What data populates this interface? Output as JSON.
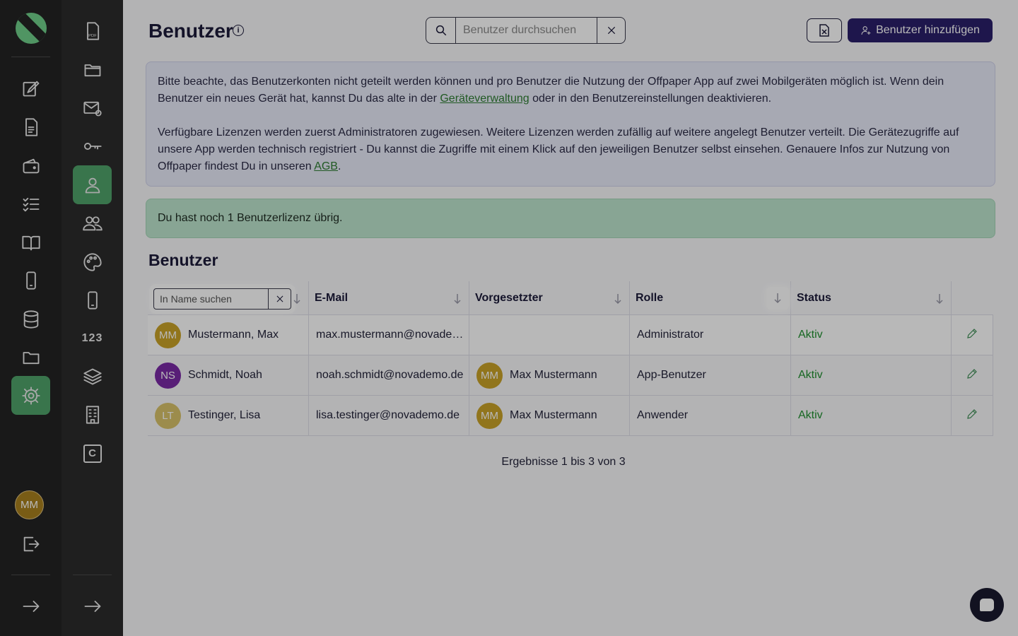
{
  "app": {
    "page_title": "Benutzer",
    "info_icon": "info-icon"
  },
  "search": {
    "placeholder": "Benutzer durchsuchen",
    "value": ""
  },
  "toolbar": {
    "export_icon": "excel-export-icon",
    "add_user_label": "Benutzer hinzufügen",
    "accent_color": "#2a1f6a"
  },
  "notice": {
    "p1_before_link": "Bitte beachte, das Benutzerkonten nicht geteilt werden können und pro Benutzer die Nutzung der Offpaper App auf zwei Mobilgeräten möglich ist. Wenn dein Benutzer ein neues Gerät hat, kannst Du das alte in der ",
    "p1_link": "Geräteverwaltung",
    "p1_after_link": " oder in den Benutzereinstellungen deaktivieren.",
    "p2_before_link": "Verfügbare Lizenzen werden zuerst Administratoren zugewiesen. Weitere Lizenzen werden zufällig auf weitere angelegt Benutzer verteilt. Die Gerätezugriffe auf unsere App werden technisch registriert - Du kannst die Zugriffe mit einem Klick auf den jeweiligen Benutzer selbst einsehen. Genauere Infos zur Nutzung von Offpaper findest Du in unseren ",
    "p2_link": "AGB",
    "p2_after_link": "."
  },
  "license_notice": "Du hast noch 1 Benutzerlizenz übrig.",
  "section_title": "Benutzer",
  "table": {
    "name_filter_placeholder": "In Name suchen",
    "columns": [
      "Name",
      "E-Mail",
      "Vorgesetzter",
      "Rolle",
      "Status"
    ],
    "rows": [
      {
        "initials": "MM",
        "avatar_color": "#c9a227",
        "name": "Mustermann, Max",
        "email": "max.mustermann@novade…",
        "boss_initials": "",
        "boss": "",
        "role": "Administrator",
        "status": "Aktiv"
      },
      {
        "initials": "NS",
        "avatar_color": "#7b2aa6",
        "name": "Schmidt, Noah",
        "email": "noah.schmidt@novademo.de",
        "boss_initials": "MM",
        "boss": "Max Mustermann",
        "role": "App-Benutzer",
        "status": "Aktiv"
      },
      {
        "initials": "LT",
        "avatar_color": "#d8c26a",
        "name": "Testinger, Lisa",
        "email": "lisa.testinger@novademo.de",
        "boss_initials": "MM",
        "boss": "Max Mustermann",
        "role": "Anwender",
        "status": "Aktiv"
      }
    ],
    "boss_avatar_color": "#c9a227",
    "status_color": "#1f8f2f"
  },
  "results_text": "Ergebnisse 1 bis 3 von 3",
  "sidebar": {
    "user_initials": "MM",
    "rail2_number_label": "123",
    "rail2_c_label": "C"
  }
}
